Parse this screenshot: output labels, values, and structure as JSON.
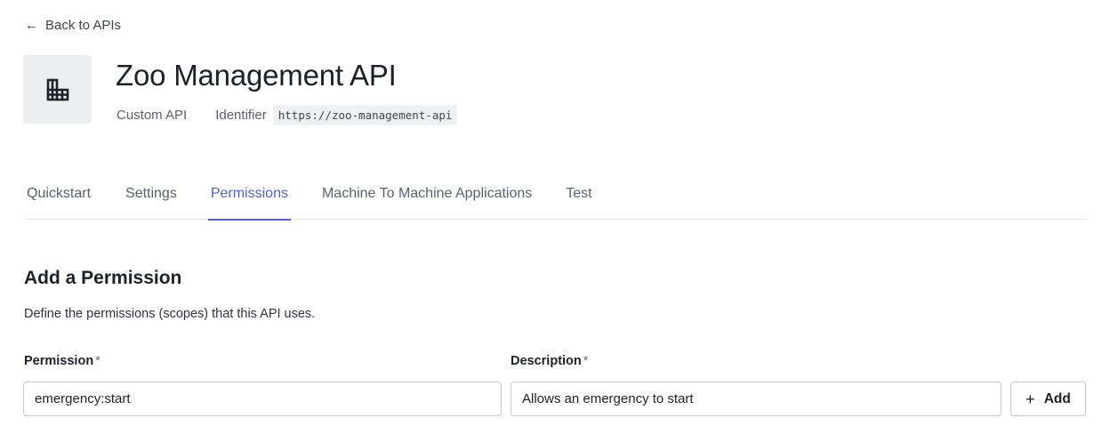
{
  "back_link": {
    "label": "Back to APIs",
    "icon": "arrow-left-icon"
  },
  "api": {
    "icon": "building-icon",
    "title": "Zoo Management API",
    "type": "Custom API",
    "identifier_label": "Identifier",
    "identifier": "https://zoo-management-api"
  },
  "tabs": [
    {
      "label": "Quickstart",
      "active": false
    },
    {
      "label": "Settings",
      "active": false
    },
    {
      "label": "Permissions",
      "active": true
    },
    {
      "label": "Machine To Machine Applications",
      "active": false
    },
    {
      "label": "Test",
      "active": false
    }
  ],
  "section": {
    "title": "Add a Permission",
    "description": "Define the permissions (scopes) that this API uses."
  },
  "form": {
    "permission_label": "Permission",
    "description_label": "Description",
    "required_mark": "*",
    "permission_value": "emergency:start",
    "description_value": "Allows an emergency to start",
    "add_label": "Add",
    "add_icon": "plus-icon"
  },
  "colors": {
    "accent": "#4f61d8",
    "text": "#1e212a",
    "muted": "#5b606e",
    "border": "#c5c8cf"
  }
}
